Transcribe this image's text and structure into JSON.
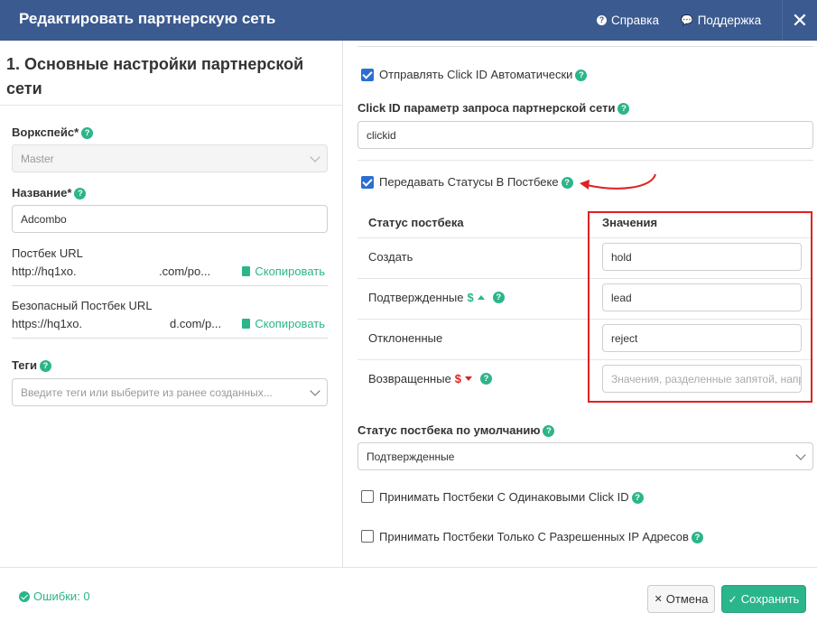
{
  "header": {
    "title": "Редактировать партнерскую сеть",
    "help_label": "Справка",
    "support_label": "Поддержка",
    "close_symbol": "✕"
  },
  "left": {
    "section_title": "1. Основные настройки партнерской сети",
    "workspace_label": "Воркспейс*",
    "workspace_value": "Master",
    "name_label": "Название*",
    "name_value": "Adcombo",
    "postback_url_label": "Постбек URL",
    "postback_url_start": "http://hq1xo.",
    "postback_url_end": ".com/po...",
    "copy_label": "Скопировать",
    "secure_postback_label": "Безопасный Постбек URL",
    "secure_postback_start": "https://hq1xo.",
    "secure_postback_end": "d.com/p...",
    "tags_label": "Теги",
    "tags_placeholder": "Введите теги или выберите из ранее созданных..."
  },
  "right": {
    "send_click_id_label": "Отправлять Click ID Автоматически",
    "send_click_id_checked": true,
    "click_id_param_label": "Click ID параметр запроса партнерской сети",
    "click_id_param_value": "clickid",
    "pass_statuses_label": "Передавать Статусы В Постбеке",
    "pass_statuses_checked": true,
    "status_table": {
      "col_status": "Статус постбека",
      "col_values": "Значения",
      "rows": [
        {
          "status": "Создать",
          "value": "hold"
        },
        {
          "status": "Подтвержденные",
          "marker": "$",
          "value": "lead"
        },
        {
          "status": "Отклоненные",
          "value": "reject"
        },
        {
          "status": "Возвращенные",
          "marker": "$",
          "placeholder": "Значения, разделенные запятой, например"
        }
      ]
    },
    "default_status_label": "Статус постбека по умолчанию",
    "default_status_value": "Подтвержденные",
    "accept_same_click_label": "Принимать Постбеки С Одинаковыми Click ID",
    "accept_same_click_checked": false,
    "accept_allowed_ip_label": "Принимать Постбеки Только С Разрешенных IP Адресов",
    "accept_allowed_ip_checked": false
  },
  "footer": {
    "errors_label": "Ошибки: 0",
    "cancel_label": "Отмена",
    "save_label": "Сохранить"
  },
  "colors": {
    "header_bg": "#3b5a8f",
    "accent_green": "#2bb58a",
    "checkbox_blue": "#2c6fd1",
    "highlight_red": "#e02020"
  }
}
